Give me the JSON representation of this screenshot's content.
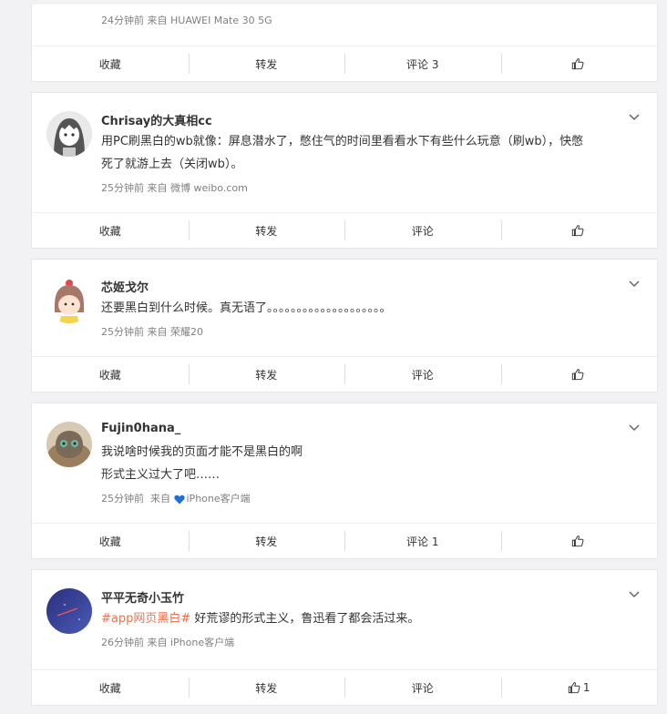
{
  "top_post": {
    "meta": "24分钟前  来自 HUAWEI Mate 30 5G",
    "actions": {
      "fav": "收藏",
      "repost": "转发",
      "comment": "评论 3",
      "like": ""
    }
  },
  "posts": [
    {
      "username": "Chrisay的大真相cc",
      "lines": [
        "用PC刷黑白的wb就像：屏息潜水了，憋住气的时间里看看水下有些什么玩意（刷wb），快憋",
        "死了就游上去（关闭wb）。"
      ],
      "meta": "25分钟前  来自 微博 weibo.com",
      "actions": {
        "fav": "收藏",
        "repost": "转发",
        "comment": "评论",
        "like": ""
      }
    },
    {
      "username": "芯姬戈尔",
      "lines": [
        "还要黑白到什么时候。真无语了。。。。。。。。。。。。。。。。。。。。"
      ],
      "meta": "25分钟前  来自 荣耀20",
      "actions": {
        "fav": "收藏",
        "repost": "转发",
        "comment": "评论",
        "like": ""
      }
    },
    {
      "username": "Fujin0hana_",
      "lines": [
        "我说啥时候我的页面才能不是黑白的啊",
        "形式主义过大了吧……"
      ],
      "meta_prefix": "25分钟前  来自 ",
      "meta_suffix": "iPhone客户端",
      "actions": {
        "fav": "收藏",
        "repost": "转发",
        "comment": "评论 1",
        "like": ""
      }
    },
    {
      "username": "平平无奇小玉竹",
      "hashtag": "#app网页黑白#",
      "text_after_hashtag": " 好荒谬的形式主义，鲁迅看了都会活过来。",
      "meta": "26分钟前  来自 iPhone客户端",
      "actions": {
        "fav": "收藏",
        "repost": "转发",
        "comment": "评论",
        "like": "1"
      }
    }
  ],
  "colors": {
    "hashtag": "#eb7350",
    "meta": "#808080",
    "heart": "#1e6fd9"
  }
}
